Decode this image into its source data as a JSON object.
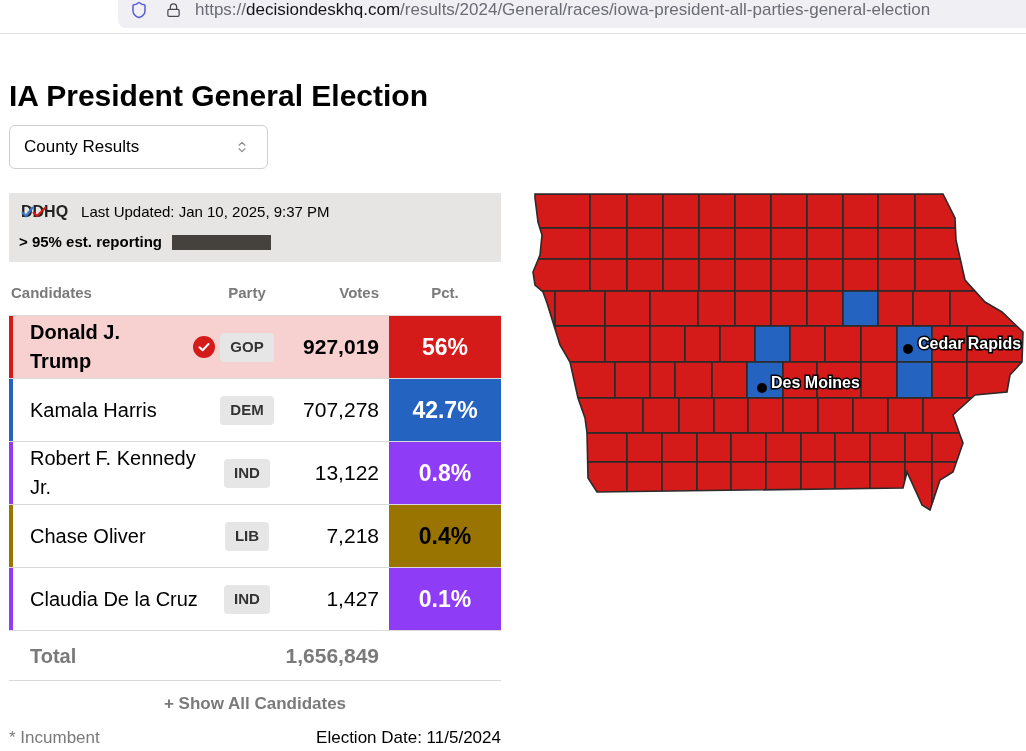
{
  "browser": {
    "url": {
      "scheme": "https://",
      "host": "decisiondeskhq.com",
      "path": "/results/2024/General/races/iowa-president-all-parties-general-election"
    }
  },
  "title": "IA President General Election",
  "view_select": {
    "value": "County Results"
  },
  "status_panel": {
    "logo": "DDHQ",
    "last_updated": "Last Updated: Jan 10, 2025, 9:37 PM",
    "reporting": "> 95% est. reporting",
    "reporting_bar": {
      "level": 1
    }
  },
  "table": {
    "columns": [
      "Candidates",
      "Party",
      "Votes",
      "Pct."
    ],
    "rows": [
      {
        "name": "Donald J. Trump",
        "winner": true,
        "party": "GOP",
        "votes": "927,019",
        "pct": "56%",
        "color": "#d51a1a"
      },
      {
        "name": "Kamala Harris",
        "winner": false,
        "party": "DEM",
        "votes": "707,278",
        "pct": "42.7%",
        "color": "#2563c0"
      },
      {
        "name": "Robert F. Kennedy Jr.",
        "winner": false,
        "party": "IND",
        "votes": "13,122",
        "pct": "0.8%",
        "color": "#8e3cf5"
      },
      {
        "name": "Chase Oliver",
        "winner": false,
        "party": "LIB",
        "votes": "7,218",
        "pct": "0.4%",
        "color": "#9a7400"
      },
      {
        "name": "Claudia De la Cruz",
        "winner": false,
        "party": "IND",
        "votes": "1,427",
        "pct": "0.1%",
        "color": "#8e3cf5"
      }
    ],
    "total": {
      "label": "Total",
      "votes": "1,656,849"
    }
  },
  "show_all_button": "+ Show All Candidates",
  "footer": {
    "note": "* Incumbent",
    "election_date": "Election Date: 11/5/2024"
  },
  "map": {
    "cities": [
      {
        "name": "Des Moines"
      },
      {
        "name": "Cedar Rapids"
      }
    ]
  }
}
